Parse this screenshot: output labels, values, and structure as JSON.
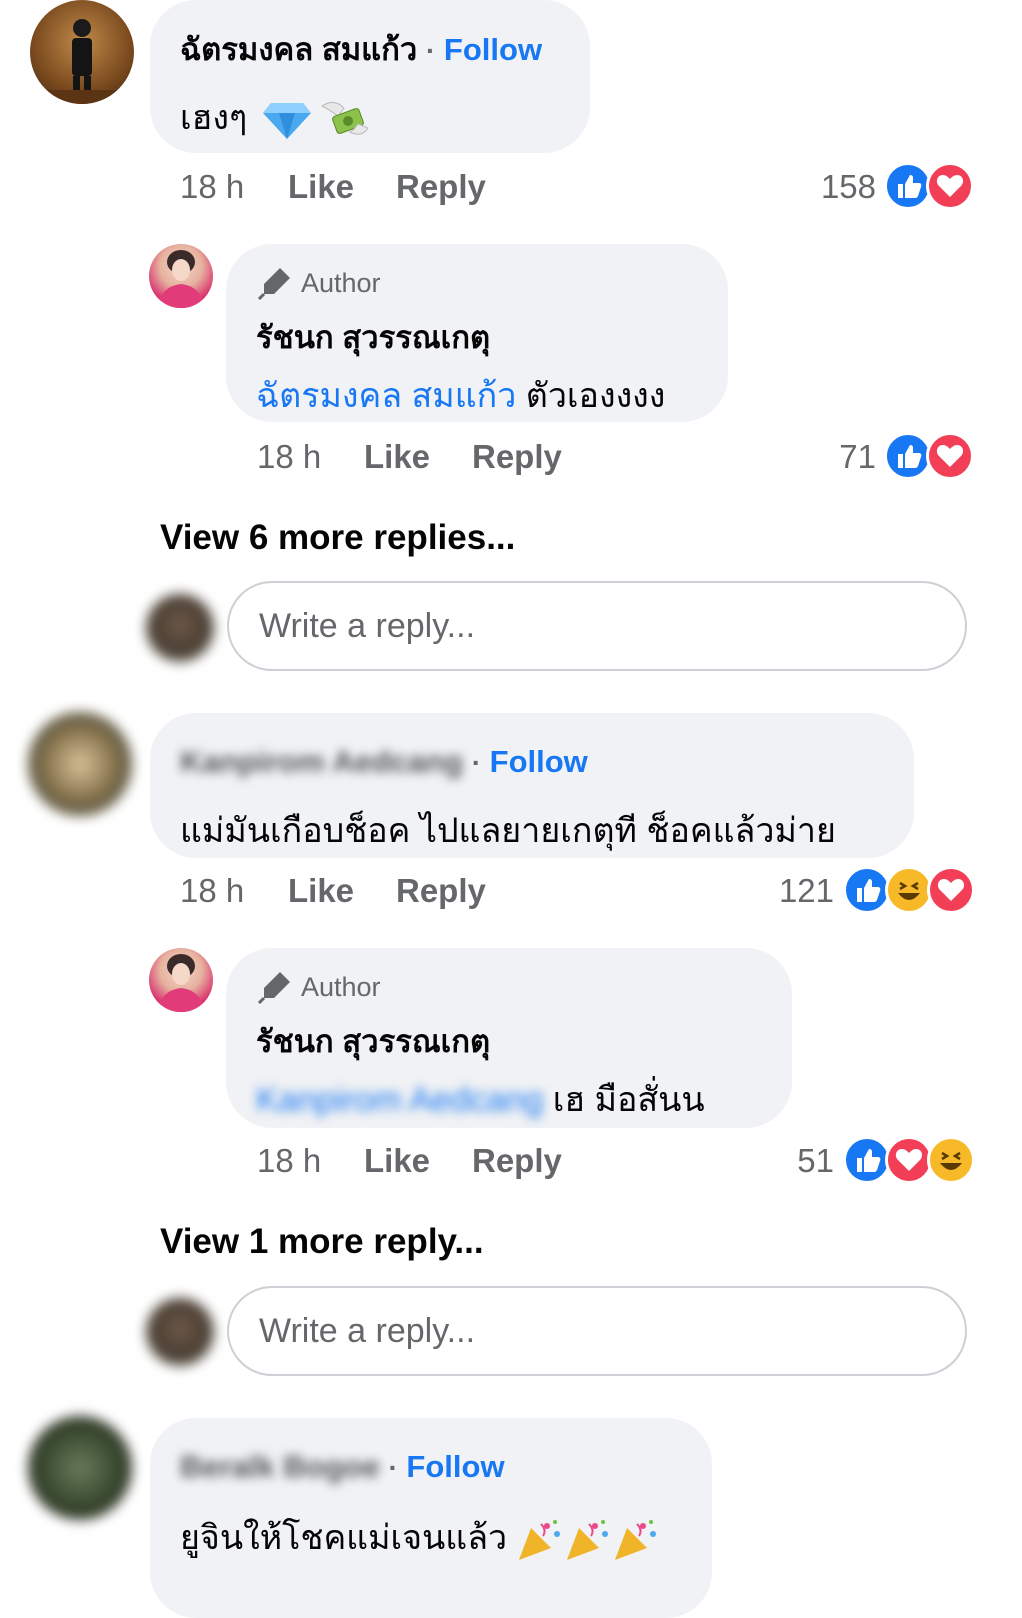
{
  "comments": [
    {
      "author": "ฉัตรมงคล สมแก้ว",
      "separator": "·",
      "follow_label": "Follow",
      "text": "เฮงๆ",
      "emoji_icons": [
        "gem-icon",
        "money-with-wings-icon"
      ],
      "time": "18 h",
      "like_label": "Like",
      "reply_label": "Reply",
      "reaction_count": "158",
      "reaction_icons": [
        "like-reaction-icon",
        "love-reaction-icon"
      ],
      "replies": [
        {
          "author_badge": "Author",
          "author": "รัชนก สุวรรณเกตุ",
          "mention": "ฉัตรมงคล สมแก้ว",
          "text": "ตัวเองงงง",
          "time": "18 h",
          "like_label": "Like",
          "reply_label": "Reply",
          "reaction_count": "71",
          "reaction_icons": [
            "like-reaction-icon",
            "love-reaction-icon"
          ]
        }
      ],
      "view_more": "View 6 more replies...",
      "reply_placeholder": "Write a reply..."
    },
    {
      "author": "Kanpirom Aedcang",
      "separator": "·",
      "follow_label": "Follow",
      "text": "แม่มันเกือบช็อค ไปแลยายเกตุที ช็อคแล้วม่าย",
      "time": "18 h",
      "like_label": "Like",
      "reply_label": "Reply",
      "reaction_count": "121",
      "reaction_icons": [
        "like-reaction-icon",
        "haha-reaction-icon",
        "love-reaction-icon"
      ],
      "replies": [
        {
          "author_badge": "Author",
          "author": "รัชนก สุวรรณเกตุ",
          "mention": "Kanpirom Aedcang",
          "text": "เฮ มือสั่นน",
          "time": "18 h",
          "like_label": "Like",
          "reply_label": "Reply",
          "reaction_count": "51",
          "reaction_icons": [
            "like-reaction-icon",
            "love-reaction-icon",
            "haha-reaction-icon"
          ]
        }
      ],
      "view_more": "View 1 more reply...",
      "reply_placeholder": "Write a reply..."
    },
    {
      "author": "Beralk Bogoe",
      "separator": "·",
      "follow_label": "Follow",
      "text": "ยูจินให้โชคแม่เจนแล้ว",
      "emoji_icons": [
        "party-popper-icon",
        "party-popper-icon",
        "party-popper-icon"
      ]
    }
  ],
  "colors": {
    "link_blue": "#1877f2",
    "bubble_bg": "#f0f2f5",
    "meta_gray": "#65676b",
    "like_blue": "#1877f2",
    "love_red": "#f33e58",
    "haha_yellow": "#f7b928"
  }
}
